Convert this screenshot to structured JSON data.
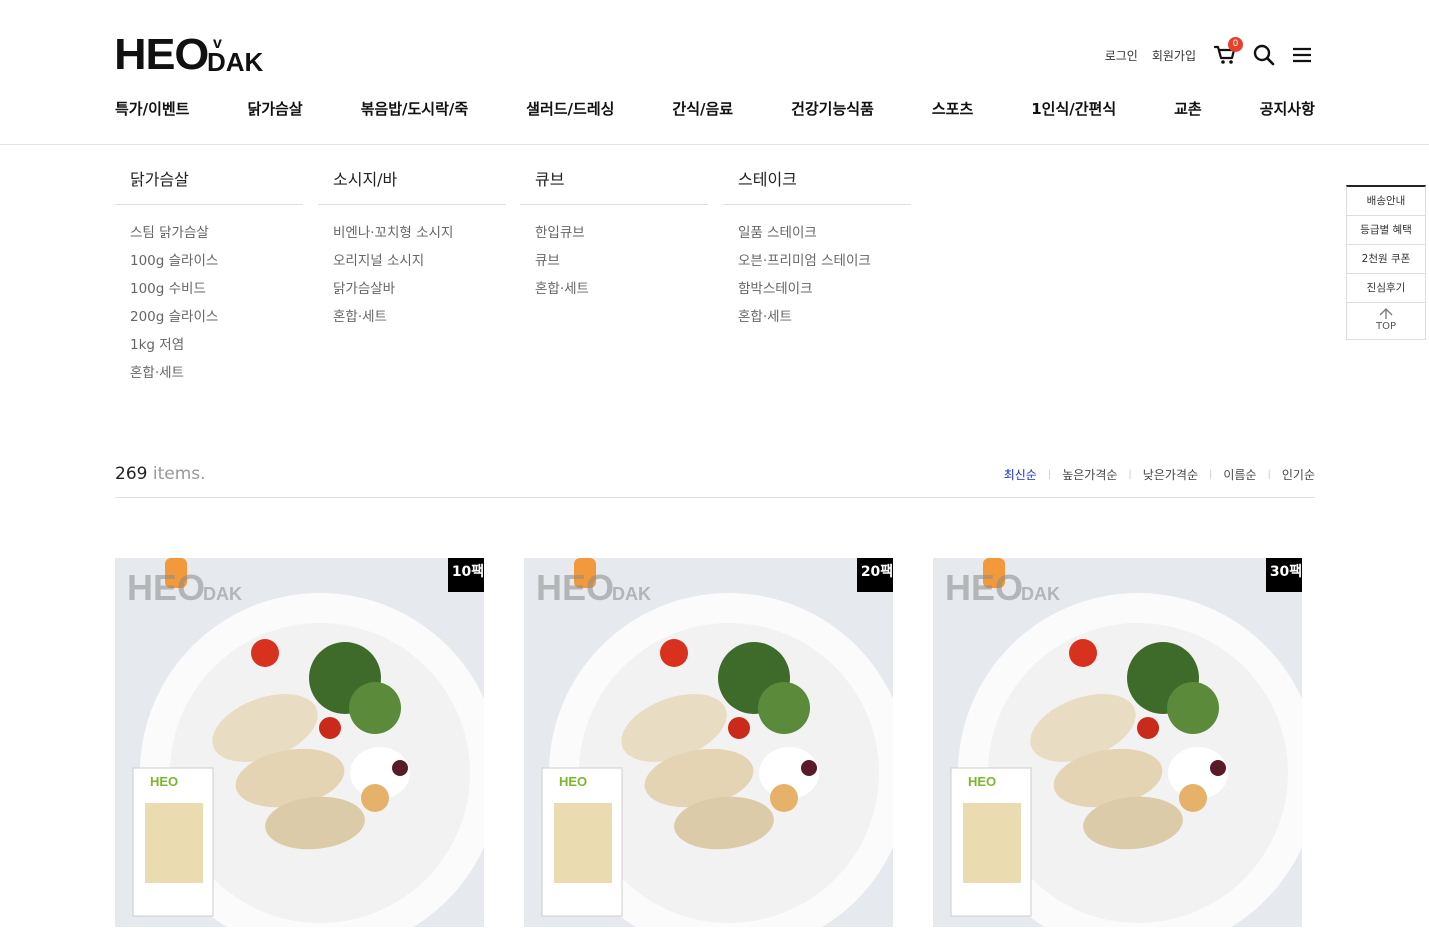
{
  "header": {
    "logo_text": "HEODAK",
    "util": {
      "login": "로그인",
      "join": "회원가입",
      "cart_count": "0"
    },
    "icons": {
      "cart": "cart-icon",
      "search": "search-icon",
      "menu": "hamburger-menu-icon"
    }
  },
  "gnb": [
    "특가/이벤트",
    "닭가슴살",
    "볶음밥/도시락/죽",
    "샐러드/드레싱",
    "간식/음료",
    "건강기능식품",
    "스포츠",
    "1인식/간편식",
    "교촌",
    "공지사항"
  ],
  "mega_menu": [
    {
      "title": "닭가슴살",
      "items": [
        "스팀 닭가슴살",
        "100g 슬라이스",
        "100g 수비드",
        "200g 슬라이스",
        "1kg 저염",
        "혼합·세트"
      ]
    },
    {
      "title": "소시지/바",
      "items": [
        "비엔나·꼬치형 소시지",
        "오리지널 소시지",
        "닭가슴살바",
        "혼합·세트"
      ]
    },
    {
      "title": "큐브",
      "items": [
        "한입큐브",
        "큐브",
        "혼합·세트"
      ]
    },
    {
      "title": "스테이크",
      "items": [
        "일품 스테이크",
        "오븐·프리미엄 스테이크",
        "함박스테이크",
        "혼합·세트"
      ]
    }
  ],
  "quick_menu": {
    "items": [
      "배송안내",
      "등급별 혜택",
      "2천원 쿠폰",
      "진심후기"
    ],
    "top": "TOP"
  },
  "list": {
    "count": "269",
    "count_suffix": " items.",
    "sort": [
      "최신순",
      "높은가격순",
      "낮은가격순",
      "이름순",
      "인기순"
    ],
    "sort_active": "최신순"
  },
  "products": [
    {
      "badge": "10팩"
    },
    {
      "badge": "20팩"
    },
    {
      "badge": "30팩"
    }
  ],
  "colors": {
    "accent_blue": "#1a2bd0",
    "cart_badge": "#e8402b"
  }
}
